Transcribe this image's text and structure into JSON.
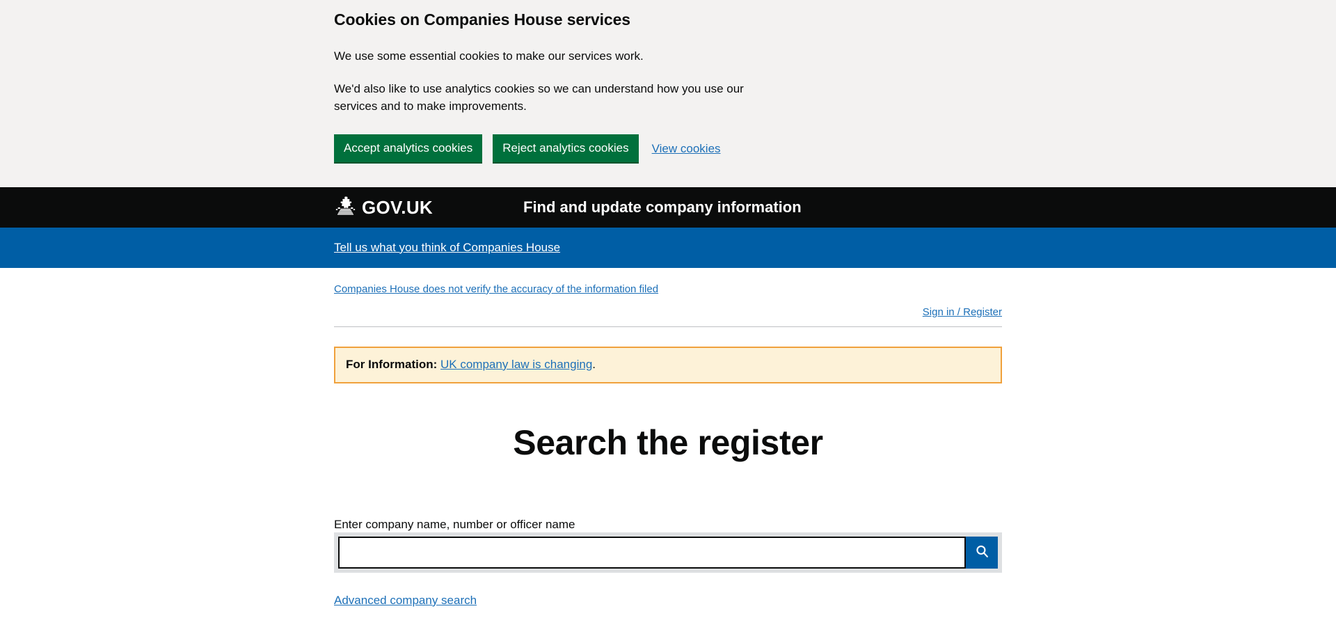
{
  "cookie_banner": {
    "title": "Cookies on Companies House services",
    "paragraph_1": "We use some essential cookies to make our services work.",
    "paragraph_2": "We'd also like to use analytics cookies so we can understand how you use our services and to make improvements.",
    "accept_label": "Accept analytics cookies",
    "reject_label": "Reject analytics cookies",
    "view_cookies_label": "View cookies"
  },
  "header": {
    "brand": "GOV.UK",
    "crown_icon": "gov-uk-crown-icon",
    "service_name": "Find and update company information"
  },
  "feedback_bar": {
    "link_label": "Tell us what you think of Companies House"
  },
  "utility": {
    "disclaimer_link": "Companies House does not verify the accuracy of the information filed",
    "sign_in_label": "Sign in / Register"
  },
  "info_banner": {
    "label": "For Information:",
    "link_label": "UK company law is changing",
    "trailing_text": "."
  },
  "main": {
    "heading": "Search the register",
    "search_label": "Enter company name, number or officer name",
    "search_value": "",
    "search_placeholder": "",
    "search_icon": "search-icon",
    "search_button_title": "Search",
    "advanced_search_label": "Advanced company search"
  },
  "colors": {
    "brand_black": "#0b0c0c",
    "govuk_blue": "#005ea5",
    "link_blue": "#1d70b8",
    "green_button": "#00703c",
    "banner_grey": "#f3f2f1",
    "search_shell_grey": "#dee0e2",
    "info_banner_bg": "#fdf2d8",
    "info_banner_border": "#f0a13c"
  }
}
